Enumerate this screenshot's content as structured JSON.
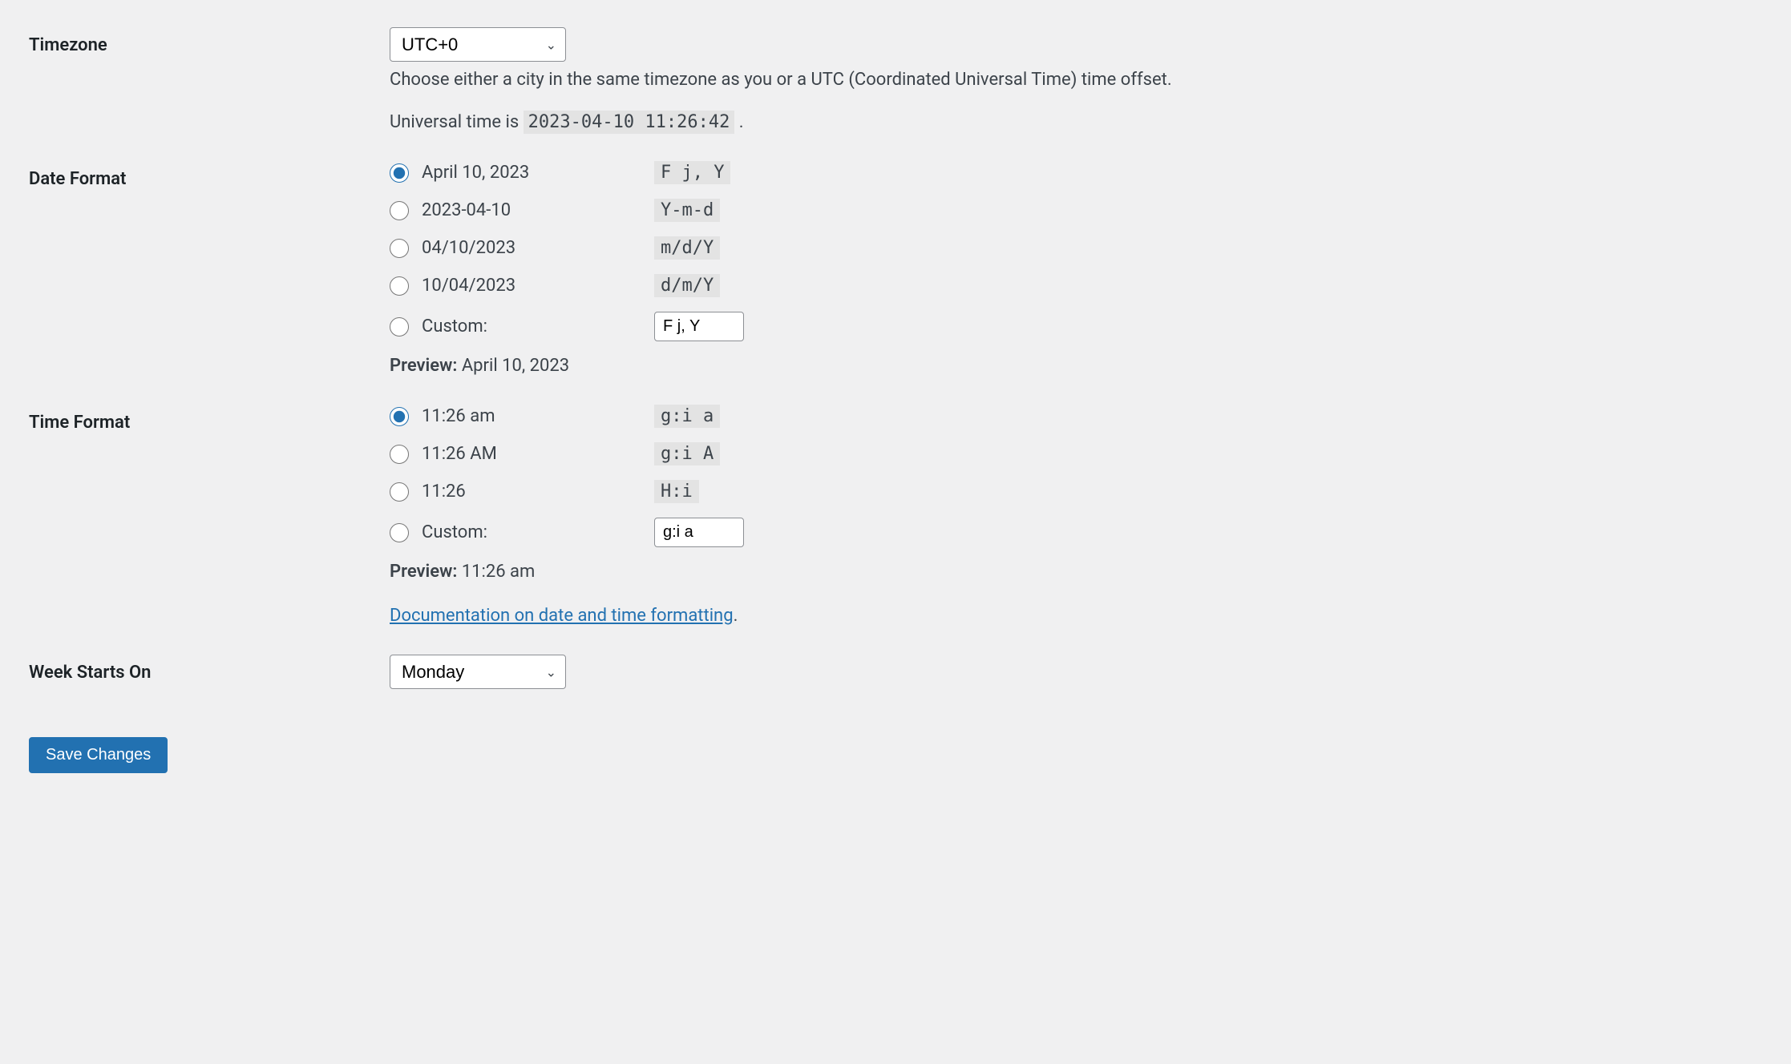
{
  "timezone": {
    "label": "Timezone",
    "value": "UTC+0",
    "description": "Choose either a city in the same timezone as you or a UTC (Coordinated Universal Time) time offset.",
    "universal_time_prefix": "Universal time is ",
    "universal_time_value": "2023-04-10 11:26:42",
    "universal_time_suffix": " ."
  },
  "date_format": {
    "label": "Date Format",
    "options": [
      {
        "example": "April 10, 2023",
        "format": "F j, Y",
        "checked": true
      },
      {
        "example": "2023-04-10",
        "format": "Y-m-d",
        "checked": false
      },
      {
        "example": "04/10/2023",
        "format": "m/d/Y",
        "checked": false
      },
      {
        "example": "10/04/2023",
        "format": "d/m/Y",
        "checked": false
      }
    ],
    "custom_label": "Custom:",
    "custom_value": "F j, Y",
    "preview_label": "Preview:",
    "preview_value": "April 10, 2023"
  },
  "time_format": {
    "label": "Time Format",
    "options": [
      {
        "example": "11:26 am",
        "format": "g:i a",
        "checked": true
      },
      {
        "example": "11:26 AM",
        "format": "g:i A",
        "checked": false
      },
      {
        "example": "11:26",
        "format": "H:i",
        "checked": false
      }
    ],
    "custom_label": "Custom:",
    "custom_value": "g:i a",
    "preview_label": "Preview:",
    "preview_value": "11:26 am",
    "doc_link_text": "Documentation on date and time formatting",
    "doc_link_suffix": "."
  },
  "week_starts": {
    "label": "Week Starts On",
    "value": "Monday"
  },
  "submit": {
    "label": "Save Changes"
  }
}
